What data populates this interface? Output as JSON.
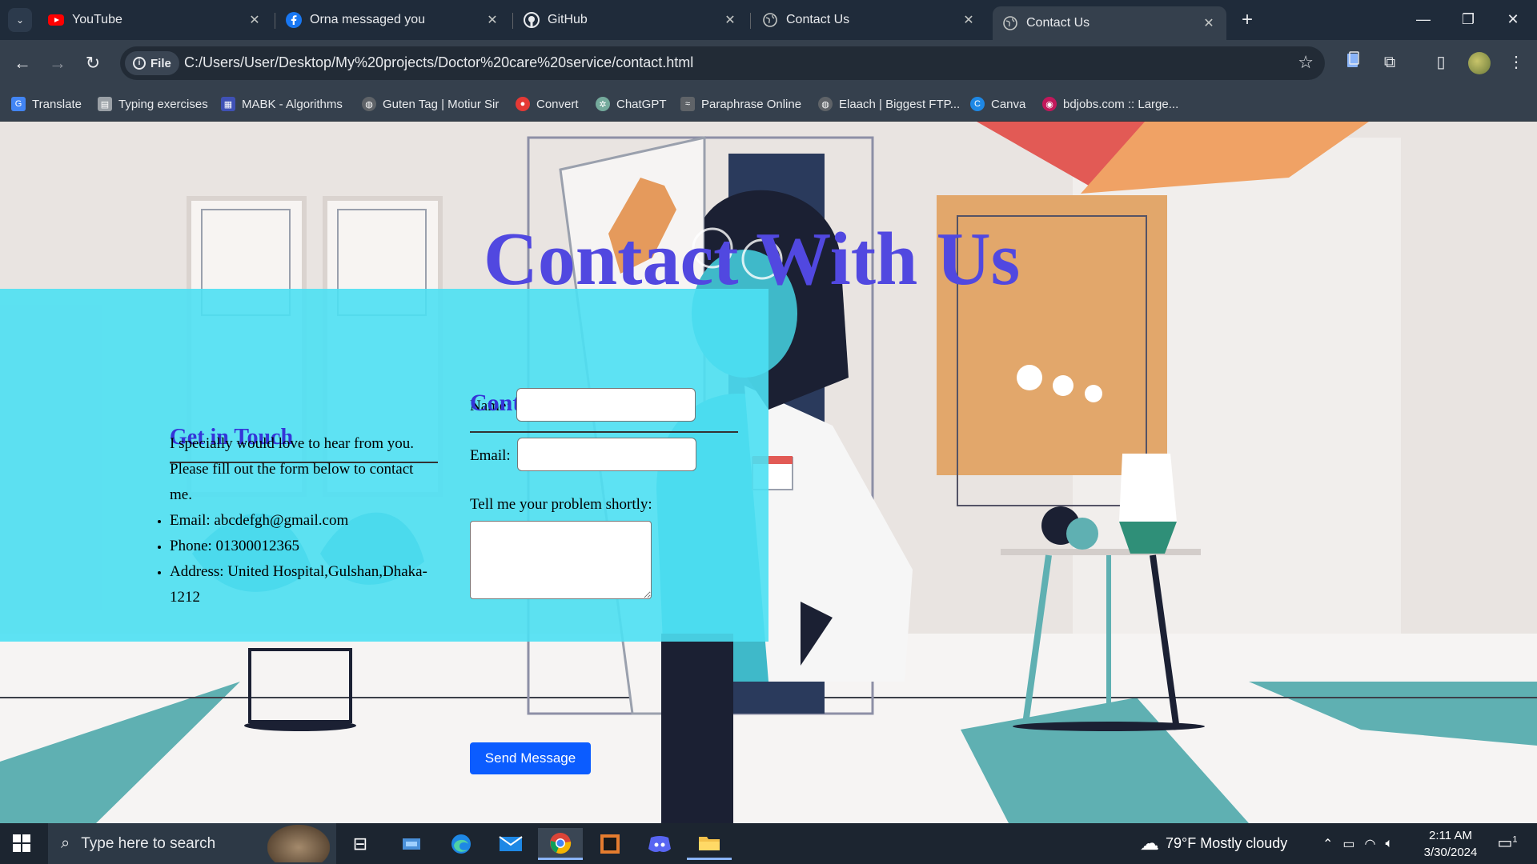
{
  "browser": {
    "tabs": [
      {
        "title": "YouTube",
        "icon": "youtube-icon"
      },
      {
        "title": "Orna messaged you",
        "icon": "facebook-icon"
      },
      {
        "title": "GitHub",
        "icon": "github-icon"
      },
      {
        "title": "Contact Us",
        "icon": "globe-icon"
      },
      {
        "title": "Contact Us",
        "icon": "globe-icon",
        "active": true
      }
    ],
    "omnibox": {
      "chip_label": "File",
      "url": "C:/Users/User/Desktop/My%20projects/Doctor%20care%20service/contact.html"
    },
    "bookmarks": [
      {
        "label": "Translate",
        "icon": "translate-icon",
        "color": "#4285f4"
      },
      {
        "label": "Typing exercises",
        "icon": "keyboard-icon",
        "color": "#9aa0a6"
      },
      {
        "label": "MABK - Algorithms",
        "icon": "algorithms-icon",
        "color": "#3f51b5"
      },
      {
        "label": "Guten Tag | Motiur Sir",
        "icon": "globe-icon",
        "color": "#9aa0a6"
      },
      {
        "label": "Convert",
        "icon": "convert-icon",
        "color": "#e53935"
      },
      {
        "label": "ChatGPT",
        "icon": "chatgpt-icon",
        "color": "#74aa9c"
      },
      {
        "label": "Paraphrase Online",
        "icon": "paraphrase-icon",
        "color": "#5f6368"
      },
      {
        "label": "Elaach | Biggest FTP...",
        "icon": "globe-icon",
        "color": "#9aa0a6"
      },
      {
        "label": "Canva",
        "icon": "canva-icon",
        "color": "#1e88e5"
      },
      {
        "label": "bdjobs.com :: Large...",
        "icon": "bdjobs-icon",
        "color": "#c2185b"
      }
    ]
  },
  "page": {
    "hero_title": "Contact With Us",
    "get_in_touch": {
      "title": "Get in Touch",
      "text": "I specially would love to hear from you. Please fill out the form below to contact me.",
      "items": [
        "Email: abcdefgh@gmail.com",
        "Phone: 01300012365",
        "Address: United Hospital,Gulshan,Dhaka-1212"
      ]
    },
    "contact_form": {
      "title": "Contact Form",
      "name_label": "Name:",
      "name_value": "",
      "email_label": "Email:",
      "email_value": "",
      "problem_label": "Tell me your problem shortly:",
      "problem_value": "",
      "submit_label": "Send Message"
    },
    "colors": {
      "heading": "#3535d8",
      "hero": "#5148e0",
      "panel": "#4de0f3",
      "button": "#0b5cff"
    }
  },
  "taskbar": {
    "search_placeholder": "Type here to search",
    "weather": "79°F  Mostly cloudy",
    "time": "2:11 AM",
    "date": "3/30/2024",
    "notification_count": "1"
  }
}
